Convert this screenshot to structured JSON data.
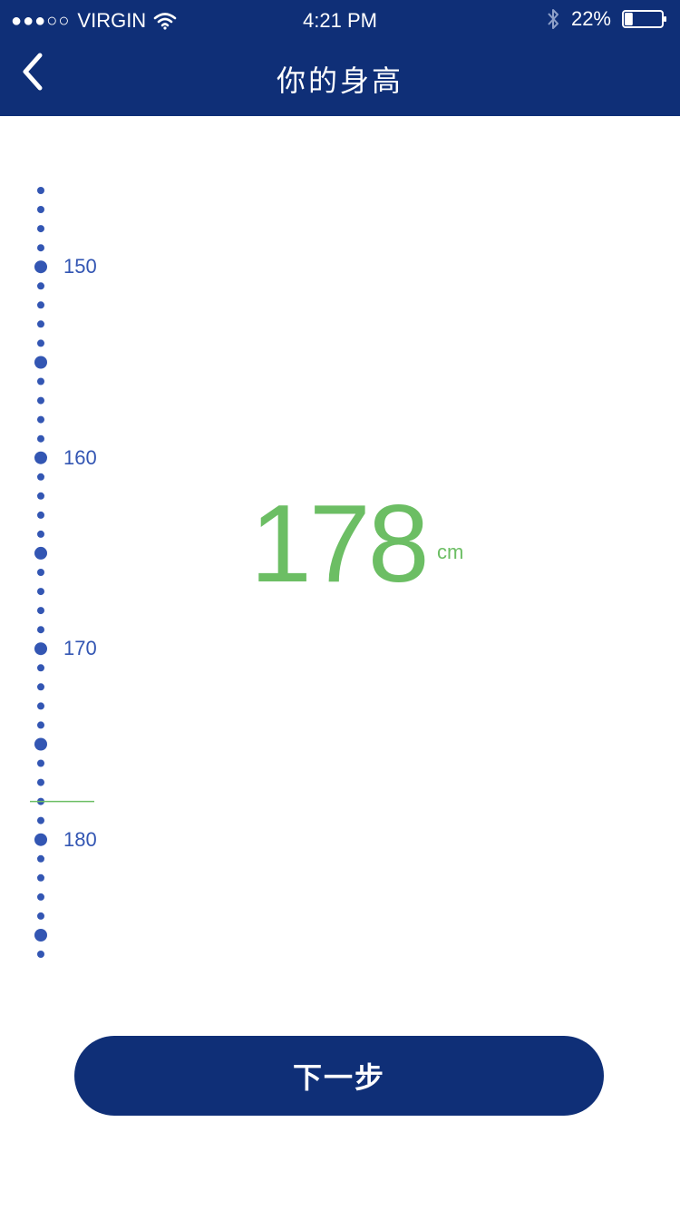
{
  "status_bar": {
    "carrier": "VIRGIN",
    "signal_dots": "●●●○○",
    "time": "4:21 PM",
    "battery_percent": "22%",
    "battery_level": 0.22,
    "icons": [
      "wifi-icon",
      "bluetooth-icon",
      "battery-icon"
    ]
  },
  "nav": {
    "title": "你的身高",
    "back_icon": "chevron-left-icon"
  },
  "ruler": {
    "labels": [
      "150",
      "160",
      "170",
      "180"
    ],
    "min": 146,
    "max": 186,
    "selected": 178,
    "indicator_color": "#6cbe64",
    "dot_color": "#3356b3"
  },
  "display": {
    "value": "178",
    "unit": "cm"
  },
  "actions": {
    "next_label": "下一步"
  },
  "colors": {
    "header_bg": "#0f2f77",
    "accent_green": "#6cbe64",
    "ruler_blue": "#3356b3",
    "button_bg": "#0f2f77"
  }
}
